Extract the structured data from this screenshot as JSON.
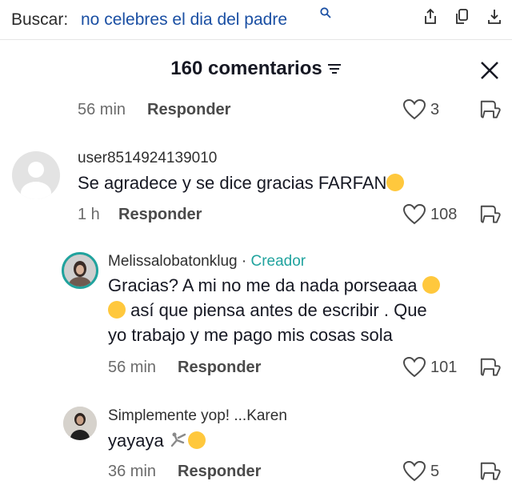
{
  "search": {
    "prefix": "Buscar:",
    "query": "no celebres el dia del padre"
  },
  "panel": {
    "title": "160 comentarios"
  },
  "comments": [
    {
      "time": "56 min",
      "reply_label": "Responder",
      "likes": "3"
    },
    {
      "username": "user8514924139010",
      "text": "Se agradece y se dice gracias FARFAN",
      "time": "1 h",
      "reply_label": "Responder",
      "likes": "108"
    },
    {
      "username": "Melissalobatonklug",
      "badge_sep": " · ",
      "badge": "Creador",
      "text_line1": "Gracias? A mi no me da nada porseaaa",
      "text_line2": " así que piensa antes de escribir . Que",
      "text_line3": "yo trabajo y me pago mis cosas sola",
      "time": "56 min",
      "reply_label": "Responder",
      "likes": "101"
    },
    {
      "username": "Simplemente yop! ...Karen",
      "text": "yayaya",
      "time": "36 min",
      "reply_label": "Responder",
      "likes": "5"
    }
  ],
  "colors": {
    "creator_badge": "#20a39e",
    "search_query": "#1a4fa3"
  },
  "icons": [
    "search-icon",
    "share-icon",
    "copy-icon",
    "download-icon",
    "filter-icon",
    "close-icon",
    "heart-icon",
    "dislike-icon"
  ]
}
